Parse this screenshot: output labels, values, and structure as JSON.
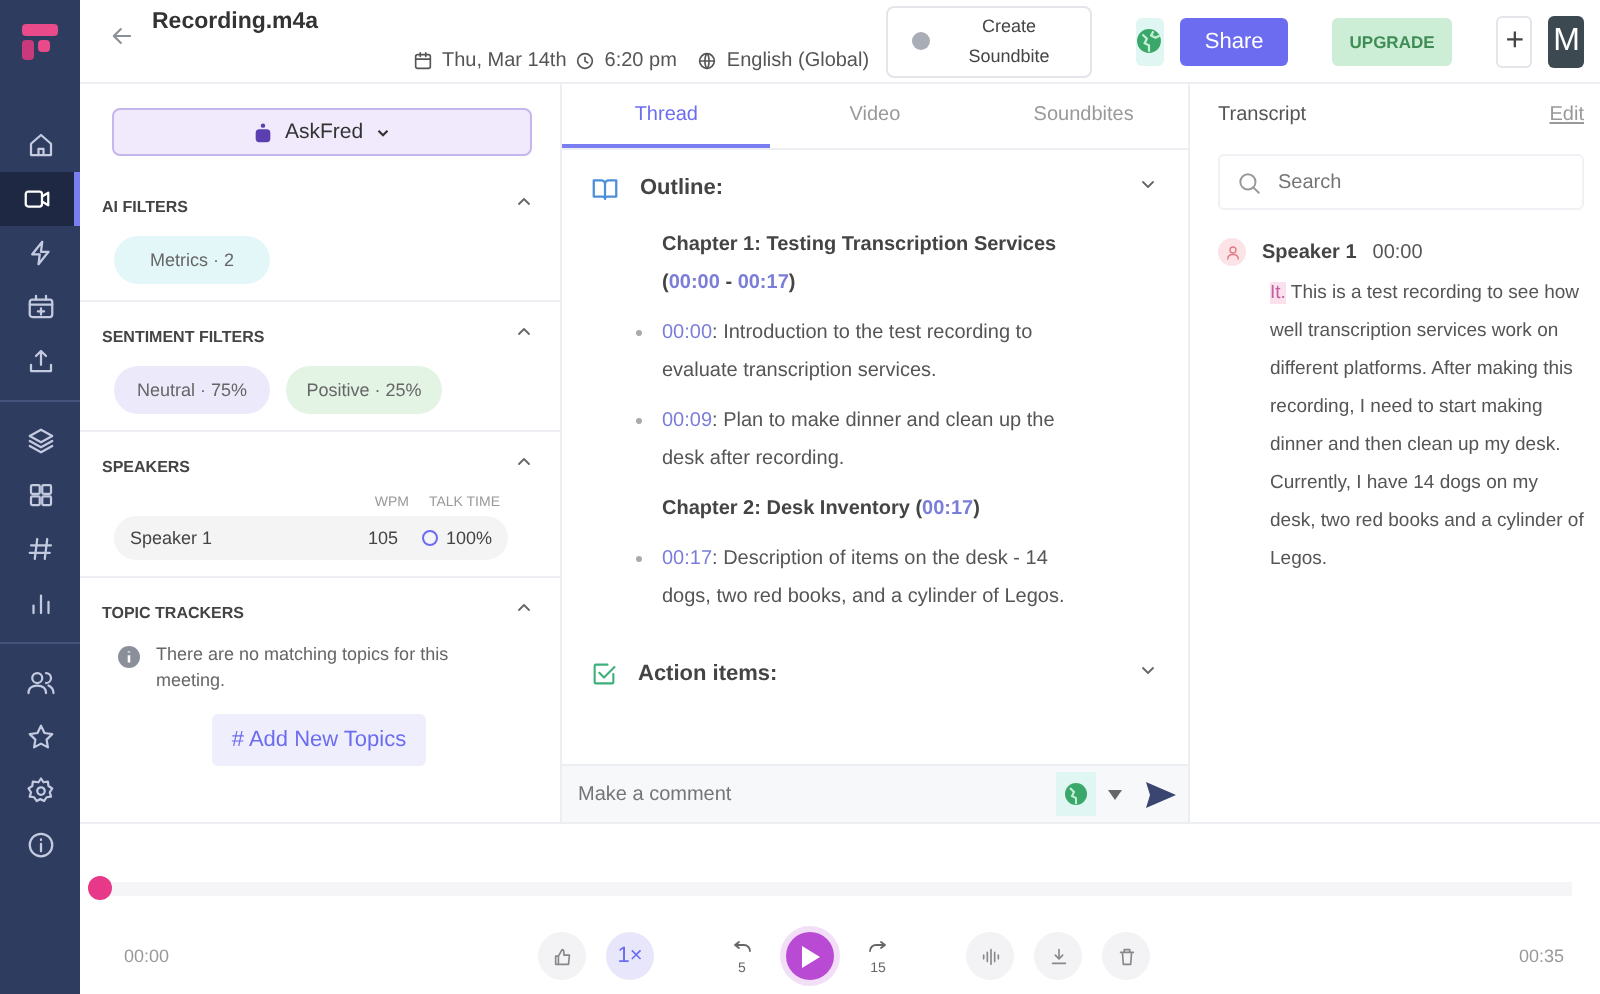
{
  "nav": {
    "items": [
      {
        "selected": false
      },
      {
        "selected": true
      },
      {
        "selected": false
      },
      {
        "selected": false
      },
      {
        "selected": false
      },
      {
        "selected": false
      },
      {
        "selected": false
      },
      {
        "selected": false
      },
      {
        "selected": false
      },
      {
        "selected": false
      },
      {
        "selected": false
      },
      {
        "selected": false
      },
      {
        "selected": false
      }
    ]
  },
  "header": {
    "title": "Recording.m4a",
    "date": "Thu, Mar 14th",
    "time": "6:20 pm",
    "language": "English (Global)",
    "create_button": "Create Soundbite",
    "share_button": "Share",
    "upgrade_button": "UPGRADE",
    "plus_button": "+",
    "avatar": "M"
  },
  "left_panel": {
    "askfred": "AskFred",
    "ai_filters": {
      "title": "AI FILTERS",
      "chips": [
        {
          "label": "Metrics · 2",
          "color": "#e3f7f8"
        }
      ]
    },
    "sentiment_filters": {
      "title": "SENTIMENT FILTERS",
      "chips": [
        {
          "label": "Neutral · 75%",
          "color": "#ece9fb"
        },
        {
          "label": "Positive · 25%",
          "color": "#e3f3e4"
        }
      ]
    },
    "speakers": {
      "title": "SPEAKERS",
      "columns": [
        "WPM",
        "TALK TIME"
      ],
      "rows": [
        {
          "name": "Speaker 1",
          "wpm": "105",
          "talk_time": "100%"
        }
      ]
    },
    "topic_trackers": {
      "title": "TOPIC TRACKERS",
      "message": "There are no matching topics for this meeting.",
      "add_button": "# Add New Topics"
    }
  },
  "thread": {
    "tabs": [
      {
        "label": "Thread",
        "selected": true
      },
      {
        "label": "Video",
        "selected": false
      },
      {
        "label": "Soundbites",
        "selected": false
      }
    ],
    "sections": [
      {
        "title": "Outline:",
        "kind": "outline",
        "blocks": [
          {
            "kind": "chapter",
            "parts": [
              {
                "kind": "plain",
                "text": "Chapter 1: Testing Transcription Services ("
              },
              {
                "kind": "time",
                "text": "00:00"
              },
              {
                "kind": "plain",
                "text": " - "
              },
              {
                "kind": "time",
                "text": "00:17"
              },
              {
                "kind": "plain",
                "text": ")"
              }
            ]
          },
          {
            "kind": "bullet",
            "parts": [
              {
                "kind": "time",
                "text": "00:00"
              },
              {
                "kind": "plain",
                "text": ": Introduction to the test recording to evaluate transcription services."
              }
            ]
          },
          {
            "kind": "bullet",
            "parts": [
              {
                "kind": "time",
                "text": "00:09"
              },
              {
                "kind": "plain",
                "text": ": Plan to make dinner and clean up the desk after recording."
              }
            ]
          },
          {
            "kind": "chapter",
            "parts": [
              {
                "kind": "plain",
                "text": "Chapter 2: Desk Inventory ("
              },
              {
                "kind": "time",
                "text": "00:17"
              },
              {
                "kind": "plain",
                "text": ")"
              }
            ]
          },
          {
            "kind": "bullet",
            "parts": [
              {
                "kind": "time",
                "text": "00:17"
              },
              {
                "kind": "plain",
                "text": ": Description of items on the desk - 14 dogs, two red books, and a cylinder of Legos."
              }
            ]
          }
        ]
      },
      {
        "title": "Action items:",
        "kind": "actions"
      }
    ],
    "comment_placeholder": "Make a comment"
  },
  "transcript": {
    "title": "Transcript",
    "edit_link": "Edit",
    "search_placeholder": "Search",
    "entries": [
      {
        "speaker": "Speaker 1",
        "time": "00:00",
        "parts": [
          {
            "kind": "highlight",
            "text": "It."
          },
          {
            "kind": "plain",
            "text": " This is a test recording to see how well transcription services work on different platforms. After making this recording, I need to start making dinner and then clean up my desk. Currently, I have 14 dogs on my desk, two red books and a cylinder of Legos."
          }
        ]
      }
    ]
  },
  "player": {
    "level": 0,
    "elapsed": "00:00",
    "duration": "00:35",
    "speed": "1×",
    "rewind": "5",
    "forward": "15"
  }
}
